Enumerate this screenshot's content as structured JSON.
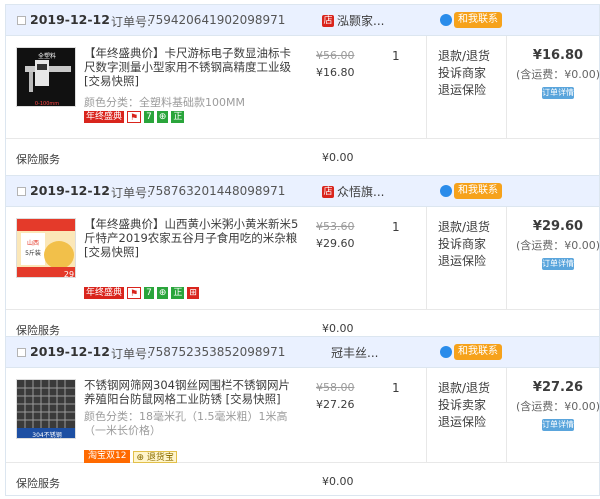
{
  "orders": [
    {
      "date": "2019-12-12",
      "order_label": "订单号:",
      "order_no": "759420641902098971",
      "shop": "泓颢家...",
      "contact": "和我联系",
      "title": "【年终盛典价】卡尺游标电子数显油标卡尺数字测量小型家用不锈钢高精度工业级 [交易快照]",
      "spec": "颜色分类：全塑料基础款100MM",
      "badges": [
        "年终盛典",
        "⚑",
        "7",
        "⊕",
        "正"
      ],
      "old_price": "¥56.00",
      "price": "¥16.80",
      "qty": "1",
      "ops": [
        "退款/退货",
        "投诉商家",
        "退运保险"
      ],
      "total": "¥16.80",
      "postage": "(含运费：¥0.00)",
      "detail_btn": "订单详情",
      "svc_label": "保险服务",
      "svc_val": "¥0.00"
    },
    {
      "date": "2019-12-12",
      "order_label": "订单号:",
      "order_no": "758763201448098971",
      "shop": "众悟旗...",
      "contact": "和我联系",
      "title": "【年终盛典价】山西黄小米粥小黄米新米5斤特产2019农家五谷月子食用吃的米杂粮 [交易快照]",
      "spec": "",
      "badges": [
        "年终盛典",
        "⚑",
        "7",
        "⊕",
        "正",
        "⊞"
      ],
      "old_price": "¥53.60",
      "price": "¥29.60",
      "qty": "1",
      "ops": [
        "退款/退货",
        "投诉商家",
        "退运保险"
      ],
      "total": "¥29.60",
      "postage": "(含运费：¥0.00)",
      "detail_btn": "订单详情",
      "svc_label": "保险服务",
      "svc_val": "¥0.00"
    },
    {
      "date": "2019-12-12",
      "order_label": "订单号:",
      "order_no": "758752353852098971",
      "shop": "冠丰丝...",
      "contact": "和我联系",
      "title": "不锈钢网筛网304钢丝网围栏不锈钢网片养殖阳台防鼠网格工业防锈 [交易快照]",
      "spec": "颜色分类：18毫米孔（1.5毫米粗）1米高（一米长价格）",
      "badges": [
        "淘宝双12",
        "⊕ 退货宝"
      ],
      "old_price": "¥58.00",
      "price": "¥27.26",
      "qty": "1",
      "ops": [
        "退款/退货",
        "投诉卖家",
        "退运保险"
      ],
      "total": "¥27.26",
      "postage": "(含运费：¥0.00)",
      "detail_btn": "订单详情",
      "svc_label": "保险服务",
      "svc_val": "¥0.00"
    }
  ]
}
